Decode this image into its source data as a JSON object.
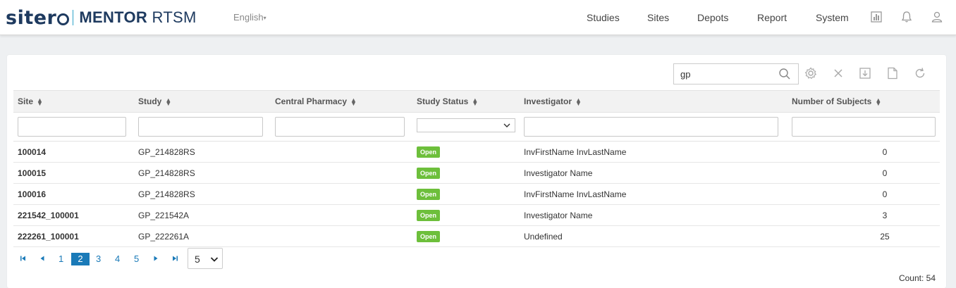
{
  "header": {
    "brand": "sitero",
    "product_bold": "MENTOR",
    "product_rest": "RTSM",
    "language": "English",
    "nav": [
      "Studies",
      "Sites",
      "Depots",
      "Report",
      "System"
    ],
    "icons": [
      "chart-icon",
      "bell-icon",
      "user-icon"
    ]
  },
  "toolbar": {
    "search_value": "gp",
    "tools": [
      "settings-icon",
      "clear-icon",
      "download-icon",
      "file-icon",
      "refresh-icon"
    ]
  },
  "table": {
    "columns": [
      "Site",
      "Study",
      "Central Pharmacy",
      "Study Status",
      "Investigator",
      "Number of Subjects"
    ],
    "rows": [
      {
        "site": "100014",
        "study": "GP_214828RS",
        "pharmacy": "",
        "status": "Open",
        "investigator": "InvFirstName InvLastName",
        "subjects": "0"
      },
      {
        "site": "100015",
        "study": "GP_214828RS",
        "pharmacy": "",
        "status": "Open",
        "investigator": "Investigator Name",
        "subjects": "0"
      },
      {
        "site": "100016",
        "study": "GP_214828RS",
        "pharmacy": "",
        "status": "Open",
        "investigator": "InvFirstName InvLastName",
        "subjects": "0"
      },
      {
        "site": "221542_100001",
        "study": "GP_221542A",
        "pharmacy": "",
        "status": "Open",
        "investigator": "Investigator Name",
        "subjects": "3"
      },
      {
        "site": "222261_100001",
        "study": "GP_222261A",
        "pharmacy": "",
        "status": "Open",
        "investigator": "Undefined",
        "subjects": "25"
      }
    ]
  },
  "pager": {
    "pages": [
      "1",
      "2",
      "3",
      "4",
      "5"
    ],
    "current": "2",
    "page_size": "5",
    "count_text": "Count: 54"
  },
  "colors": {
    "accent": "#1a7ab8",
    "status_open": "#6dbf3b",
    "brand_navy": "#1e3a5f"
  }
}
